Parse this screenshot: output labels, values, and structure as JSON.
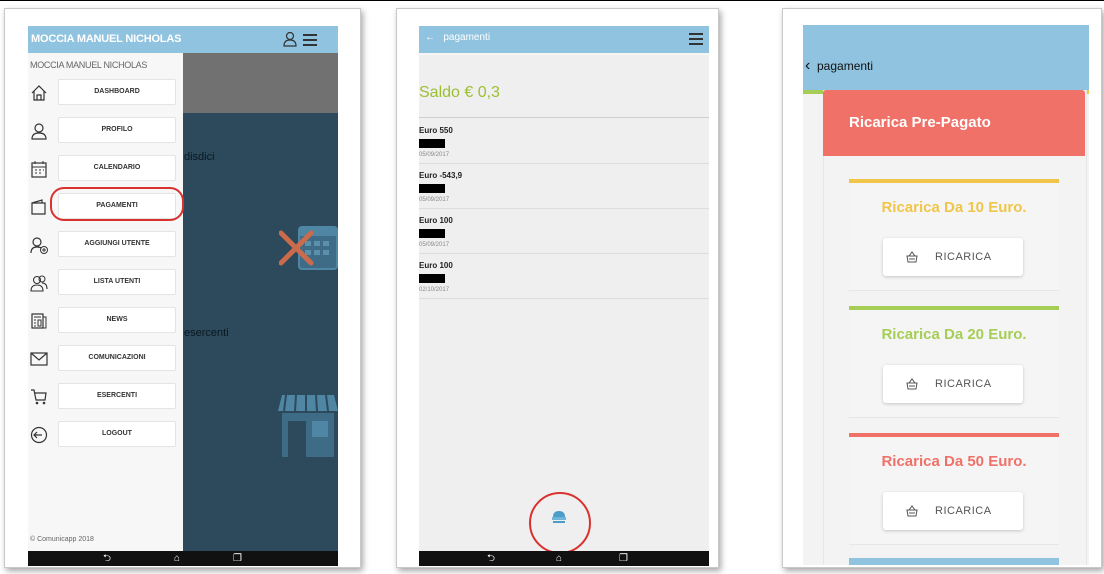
{
  "screen1": {
    "header_title": "MOCCIA MANUEL NICHOLAS",
    "drawer_user": "MOCCIA MANUEL NICHOLAS",
    "menu": [
      {
        "label": "DASHBOARD",
        "icon": "home-icon"
      },
      {
        "label": "PROFILO",
        "icon": "user-icon"
      },
      {
        "label": "CALENDARIO",
        "icon": "calendar-icon"
      },
      {
        "label": "PAGAMENTI",
        "icon": "wallet-icon"
      },
      {
        "label": "AGGIUNGI UTENTE",
        "icon": "add-user-icon"
      },
      {
        "label": "LISTA UTENTI",
        "icon": "users-icon"
      },
      {
        "label": "NEWS",
        "icon": "news-icon"
      },
      {
        "label": "COMUNICAZIONI",
        "icon": "mail-icon"
      },
      {
        "label": "ESERCENTI",
        "icon": "cart-icon"
      },
      {
        "label": "LOGOUT",
        "icon": "logout-icon"
      }
    ],
    "bg_text_1": "disdici",
    "bg_text_2": "esercenti",
    "footer": "© Comunicapp 2018"
  },
  "screen2": {
    "title": "pagamenti",
    "saldo": "Saldo € 0,3",
    "payments": [
      {
        "amount": "Euro 550",
        "date": "05/09/2017"
      },
      {
        "amount": "Euro -543,9",
        "date": "05/09/2017"
      },
      {
        "amount": "Euro 100",
        "date": "05/09/2017"
      },
      {
        "amount": "Euro 100",
        "date": "02/10/2017"
      }
    ]
  },
  "screen3": {
    "title": "pagamenti",
    "header": "Ricarica Pre-Pagato",
    "options": [
      {
        "title": "Ricarica Da 10 Euro.",
        "button": "RICARICA",
        "color": "#f0c64a"
      },
      {
        "title": "Ricarica Da 20 Euro.",
        "button": "RICARICA",
        "color": "#a6cd55"
      },
      {
        "title": "Ricarica Da 50 Euro.",
        "button": "RICARICA",
        "color": "#ef7168"
      }
    ]
  },
  "colors": {
    "topbar": "#8fc3df",
    "saldo_green": "#9cbf32",
    "header_red": "#ef7168",
    "highlight_red": "#d9322e"
  }
}
